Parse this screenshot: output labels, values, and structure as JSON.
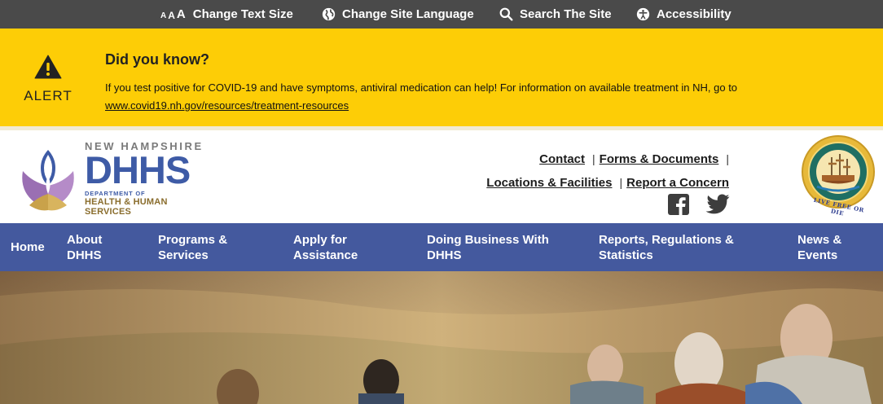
{
  "utility_bar": {
    "text_size_glyphs": [
      "A",
      "A",
      "A"
    ],
    "text_size_label": "Change Text Size",
    "language_label": "Change Site Language",
    "search_label": "Search The Site",
    "accessibility_label": "Accessibility"
  },
  "alert": {
    "side_label": "ALERT",
    "title": "Did you know?",
    "message": "If you test positive for COVID-19 and have symptoms, antiviral medication can help! For information on available treatment in NH, go to",
    "link_text": "www.covid19.nh.gov/resources/treatment-resources",
    "background_color": "#fdcd06"
  },
  "logo": {
    "state": "NEW HAMPSHIRE",
    "acronym": "DHHS",
    "department_line": "DEPARTMENT OF",
    "name_line": "HEALTH & HUMAN SERVICES"
  },
  "header_links": {
    "contact": "Contact",
    "forms": "Forms & Documents",
    "locations": "Locations & Facilities",
    "report": "Report a Concern",
    "separator": "|"
  },
  "social": {
    "facebook_icon": "facebook-icon",
    "twitter_icon": "twitter-icon"
  },
  "seal": {
    "motto": "LIVE FREE OR DIE"
  },
  "nav": {
    "color": "#44599e",
    "items": [
      {
        "line1": "Home",
        "line2": ""
      },
      {
        "line1": "About",
        "line2": "DHHS"
      },
      {
        "line1": "Programs &",
        "line2": "Services"
      },
      {
        "line1": "Apply for",
        "line2": "Assistance"
      },
      {
        "line1": "Doing Business With",
        "line2": "DHHS"
      },
      {
        "line1": "Reports, Regulations &",
        "line2": "Statistics"
      },
      {
        "line1": "News &",
        "line2": "Events"
      }
    ]
  }
}
